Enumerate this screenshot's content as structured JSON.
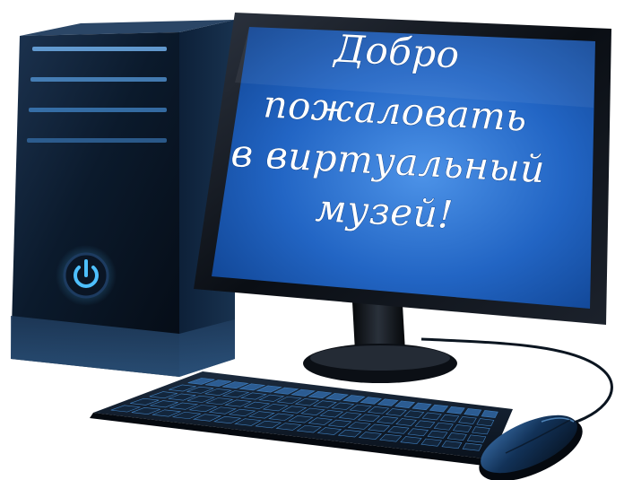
{
  "screen": {
    "greeting_lines": [
      "Добро",
      "пожаловать",
      "в виртуальный",
      "музей!"
    ]
  },
  "colors": {
    "screen_blue": "#1f66c6",
    "screen_dark_blue": "#0d3e89",
    "case_black": "#0b1a2c",
    "glow_blue": "#4ec0ff"
  },
  "icons": {
    "power_button": "power-icon"
  }
}
